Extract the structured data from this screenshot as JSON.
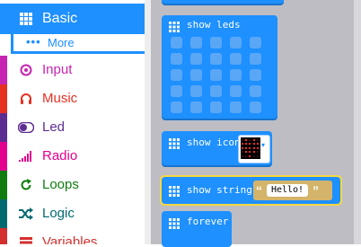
{
  "toolbox": {
    "basic": {
      "label": "Basic",
      "icon": "grid-icon",
      "color": "#1e90ff"
    },
    "more": {
      "label": "More",
      "icon": "more-dots-icon"
    },
    "categories": [
      {
        "key": "input",
        "label": "Input",
        "icon": "target-icon",
        "color": "#c724b1",
        "text_color": "#c724b1"
      },
      {
        "key": "music",
        "label": "Music",
        "icon": "headphones-icon",
        "color": "#e63022",
        "text_color": "#e63022"
      },
      {
        "key": "led",
        "label": "Led",
        "icon": "toggle-icon",
        "color": "#5c2d91",
        "text_color": "#5c2d91"
      },
      {
        "key": "radio",
        "label": "Radio",
        "icon": "signal-bars-icon",
        "color": "#e3008c",
        "text_color": "#e3008c"
      },
      {
        "key": "loops",
        "label": "Loops",
        "icon": "refresh-icon",
        "color": "#107c10",
        "text_color": "#107c10"
      },
      {
        "key": "logic",
        "label": "Logic",
        "icon": "shuffle-icon",
        "color": "#006970",
        "text_color": "#006970"
      },
      {
        "key": "variables",
        "label": "Variables",
        "icon": "list-icon",
        "color": "#d42f2f",
        "text_color": "#d42f2f"
      }
    ]
  },
  "blocks": {
    "show_leds": {
      "label": "show leds"
    },
    "show_icon": {
      "label": "show icon"
    },
    "show_string": {
      "label": "show string",
      "value": "Hello!",
      "open_quote": "“",
      "close_quote": "”"
    },
    "forever": {
      "label": "forever"
    }
  },
  "colors": {
    "block_blue": "#1e90ff",
    "highlight": "#f5d742",
    "workspace": "#bdbdc3"
  }
}
